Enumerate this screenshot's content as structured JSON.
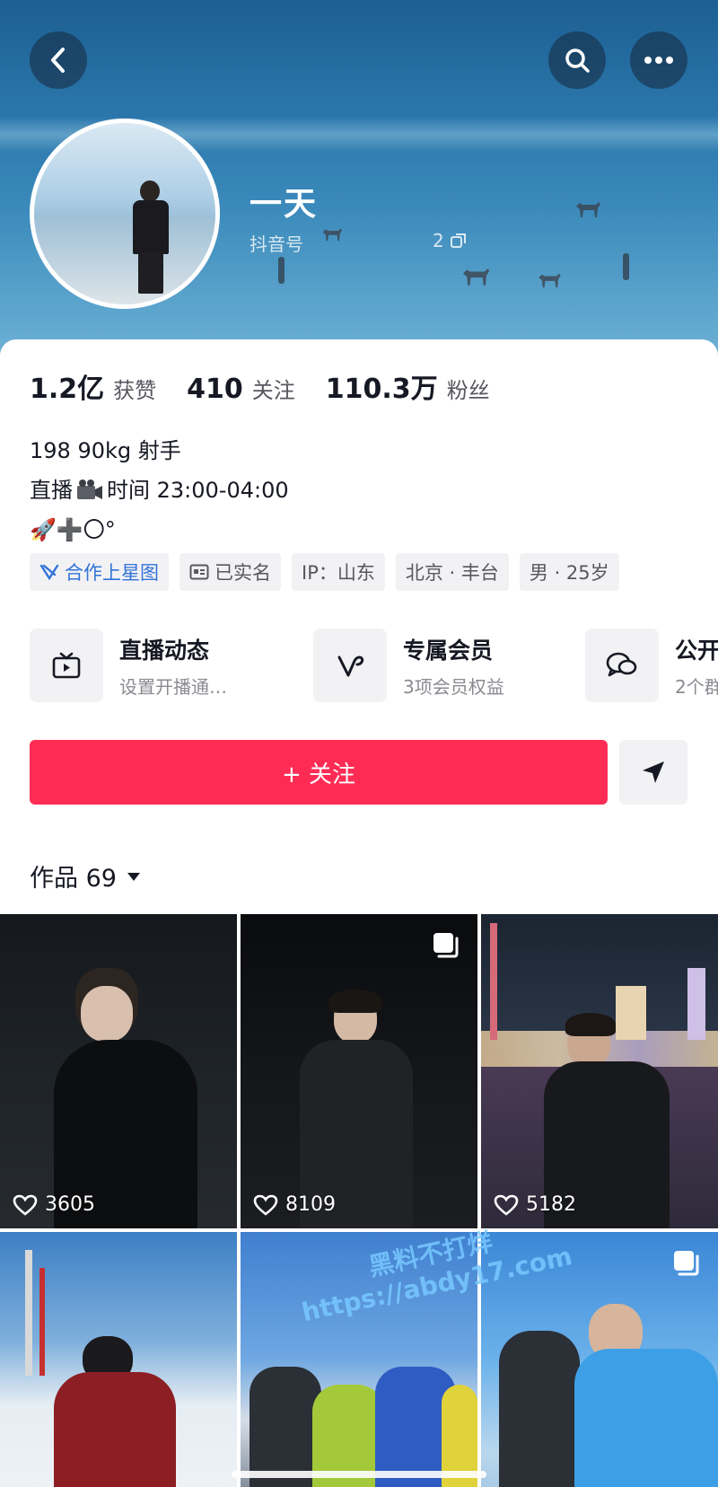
{
  "profile": {
    "name": "一天",
    "douyin_id_label": "抖音号",
    "id_count": "2"
  },
  "stats": [
    {
      "value": "1.2亿",
      "label": "获赞"
    },
    {
      "value": "410",
      "label": "关注"
    },
    {
      "value": "110.3万",
      "label": "粉丝"
    }
  ],
  "bio": {
    "line1": "198 90kg 射手",
    "line2_prefix": "直播",
    "line2_suffix": "时间 23:00-04:00",
    "line3": "🚀➕〇°"
  },
  "tags": {
    "star": "合作上星图",
    "verified": "已实名",
    "ip": "IP：山东",
    "location": "北京 · 丰台",
    "gender_age": "男 · 25岁"
  },
  "features": [
    {
      "title": "直播动态",
      "subtitle": "设置开播通…",
      "icon": "tv-icon"
    },
    {
      "title": "专属会员",
      "subtitle": "3项会员权益",
      "icon": "v-icon"
    },
    {
      "title": "公开",
      "subtitle": "2个群",
      "icon": "chat-icon"
    }
  ],
  "actions": {
    "follow_label": "+ 关注"
  },
  "works": {
    "label": "作品 69"
  },
  "videos": [
    {
      "likes": "3605",
      "multi": false
    },
    {
      "likes": "8109",
      "multi": true
    },
    {
      "likes": "5182",
      "multi": false
    },
    {
      "likes": "",
      "multi": false
    },
    {
      "likes": "",
      "multi": false
    },
    {
      "likes": "",
      "multi": true
    }
  ],
  "watermark": {
    "line1": "黑料不打烊",
    "line2": "https://abdy17.com"
  },
  "colors": {
    "accent": "#fe2c55",
    "link": "#3273d8"
  }
}
